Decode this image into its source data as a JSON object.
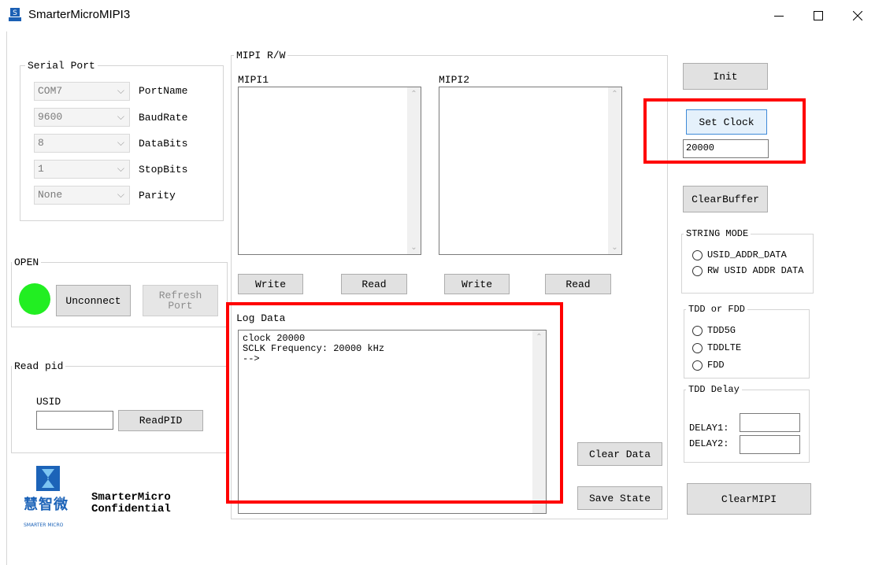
{
  "window": {
    "title": "SmarterMicroMIPI3"
  },
  "serial_port": {
    "legend": "Serial Port",
    "fields": [
      {
        "value": "COM7",
        "label": "PortName"
      },
      {
        "value": "9600",
        "label": "BaudRate"
      },
      {
        "value": "8",
        "label": "DataBits"
      },
      {
        "value": "1",
        "label": "StopBits"
      },
      {
        "value": "None",
        "label": "Parity"
      }
    ]
  },
  "open": {
    "legend": "OPEN",
    "unconnect_label": "Unconnect",
    "refresh_label": "Refresh\nPort",
    "indicator_color": "#22ee22"
  },
  "read_pid": {
    "legend": "Read pid",
    "usid_label": "USID",
    "usid_value": "",
    "read_label": "ReadPID"
  },
  "logo": {
    "brand_cn": "慧智微",
    "brand_en": "SMARTER MICRO",
    "line1": "SmarterMicro",
    "line2": "Confidential"
  },
  "mipi_rw": {
    "legend": "MIPI R/W",
    "mipi1_label": "MIPI1",
    "mipi2_label": "MIPI2",
    "mipi1_value": "",
    "mipi2_value": "",
    "write1_label": "Write",
    "read1_label": "Read",
    "write2_label": "Write",
    "read2_label": "Read"
  },
  "log": {
    "legend": "Log Data",
    "text": "clock 20000\nSCLK Frequency: 20000 kHz\n-->",
    "clear_label": "Clear Data",
    "save_label": "Save State"
  },
  "right": {
    "init_label": "Init",
    "set_clock_label": "Set Clock",
    "clock_value": "20000",
    "clear_buffer_label": "ClearBuffer",
    "clear_mipi_label": "ClearMIPI"
  },
  "string_mode": {
    "legend": "STRING MODE",
    "options": [
      "USID_ADDR_DATA",
      "RW USID ADDR DATA"
    ]
  },
  "tdd_fdd": {
    "legend": "TDD or FDD",
    "options": [
      "TDD5G",
      "TDDLTE",
      "FDD"
    ]
  },
  "tdd_delay": {
    "legend": "TDD Delay",
    "delay1_label": "DELAY1:",
    "delay2_label": "DELAY2:",
    "delay1_value": "",
    "delay2_value": ""
  },
  "colors": {
    "highlight": "#ff0000",
    "focus": "#3f8ad8"
  }
}
